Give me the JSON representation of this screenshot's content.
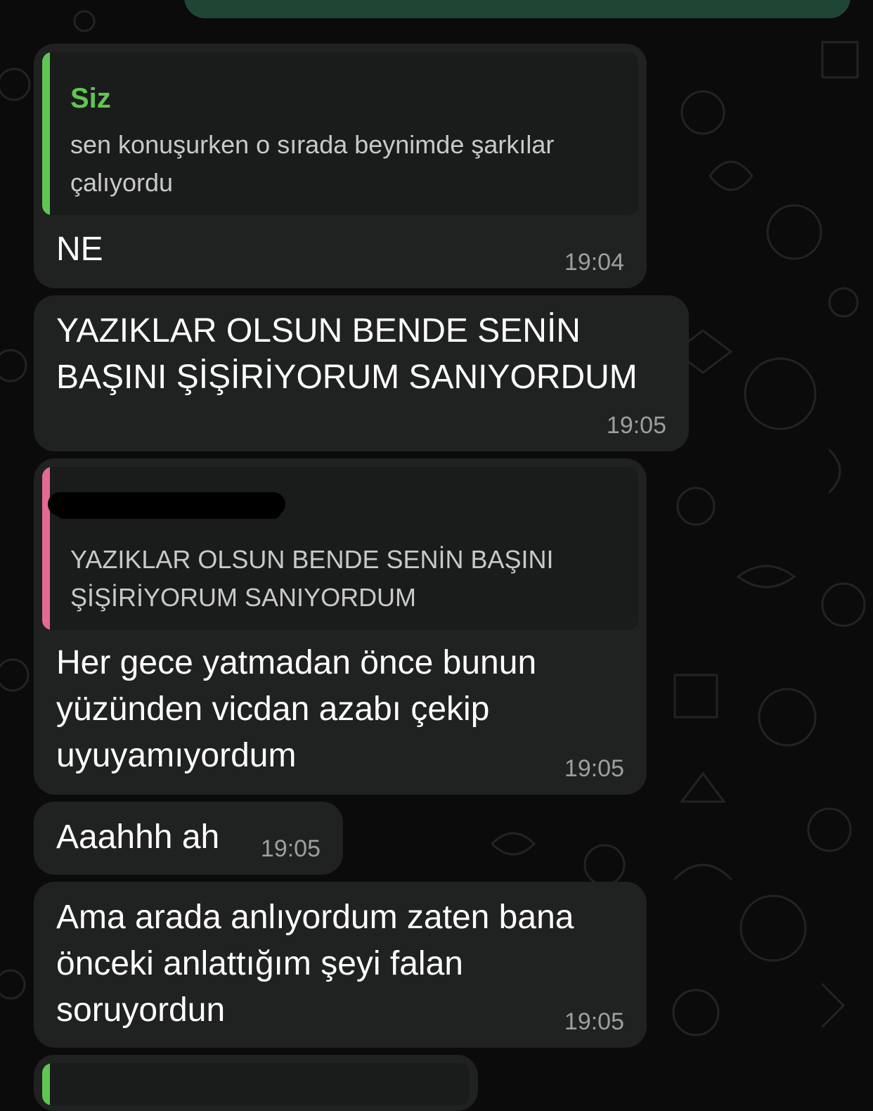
{
  "messages": [
    {
      "quote": {
        "author": "Siz",
        "text": "sen konuşurken o sırada beynimde şarkılar\nçalıyordu"
      },
      "text": "NE",
      "time": "19:04"
    },
    {
      "text": "YAZIKLAR OLSUN BENDE SENİN\nBAŞINI ŞİŞİRİYORUM SANIYORDUM",
      "time": "19:05"
    },
    {
      "quote": {
        "author": "",
        "text": "YAZIKLAR OLSUN BENDE SENİN BAŞINI\nŞİŞİRİYORUM SANIYORDUM"
      },
      "text": "Her gece yatmadan önce bunun\nyüzünden vicdan azabı çekip\nuyuyamıyordum",
      "time": "19:05"
    },
    {
      "text": "Aaahhh ah",
      "time": "19:05"
    },
    {
      "text": "Ama arada anlıyordum zaten bana\nönceki anlattığım şeyi falan\nsoruyordun",
      "time": "19:05"
    }
  ],
  "colors": {
    "background": "#0b0b0b",
    "bubble_incoming": "#202121",
    "bubble_outgoing": "#1f4634",
    "quote_bar_self": "#61c554",
    "quote_bar_other": "#e36a93",
    "timestamp": "#9aa0a0"
  }
}
